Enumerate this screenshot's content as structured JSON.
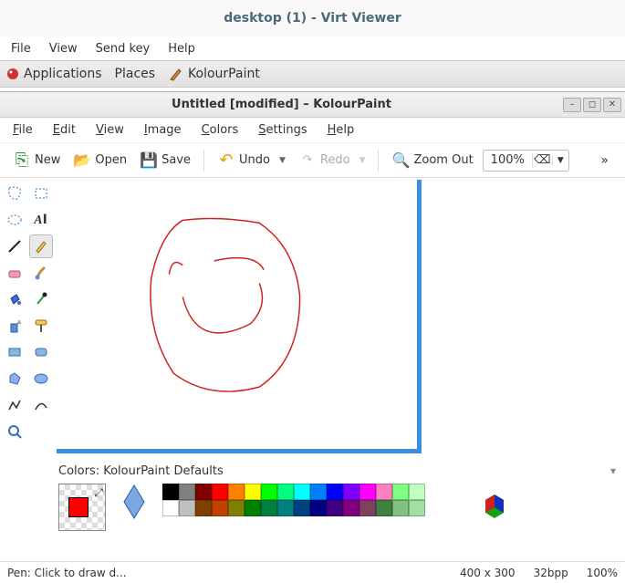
{
  "virt": {
    "title": "desktop (1) - Virt Viewer",
    "menu": [
      "File",
      "View",
      "Send key",
      "Help"
    ]
  },
  "gnome": {
    "applications": "Applications",
    "places": "Places",
    "task": "KolourPaint"
  },
  "window": {
    "title": "Untitled [modified] – KolourPaint"
  },
  "menubar": {
    "file": "File",
    "edit": "Edit",
    "view": "View",
    "image": "Image",
    "colors": "Colors",
    "settings": "Settings",
    "help": "Help"
  },
  "toolbar": {
    "new": "New",
    "open": "Open",
    "save": "Save",
    "undo": "Undo",
    "redo": "Redo",
    "zoom_out": "Zoom Out",
    "zoom_value": "100%"
  },
  "tools": [
    "free-select",
    "rect-select",
    "ellipse-select",
    "text",
    "line",
    "pen",
    "eraser",
    "brush",
    "fill",
    "color-picker",
    "spray",
    "roller",
    "rect",
    "rounded-rect",
    "polygon",
    "ellipse",
    "polyline",
    "curve",
    "zoom"
  ],
  "selected_tool": "pen",
  "colors_section": {
    "label": "Colors: KolourPaint Defaults",
    "foreground": "#ff0000",
    "palette_row1": [
      "#000000",
      "#808080",
      "#800000",
      "#ff0000",
      "#ff8000",
      "#ffff00",
      "#00ff00",
      "#00ff80",
      "#00ffff",
      "#0080ff",
      "#0000ff",
      "#8000ff",
      "#ff00ff",
      "#ff80c0",
      "#80ff80",
      "#c0ffc0"
    ],
    "palette_row2": [
      "#ffffff",
      "#c0c0c0",
      "#804000",
      "#c04000",
      "#808000",
      "#008000",
      "#008040",
      "#008080",
      "#004080",
      "#000080",
      "#400080",
      "#800080",
      "#804060",
      "#408040",
      "#80c080",
      "#a0e0a0"
    ]
  },
  "status": {
    "hint": "Pen: Click to draw d...",
    "dims": "400 x 300",
    "depth": "32bpp",
    "zoom": "100%"
  }
}
